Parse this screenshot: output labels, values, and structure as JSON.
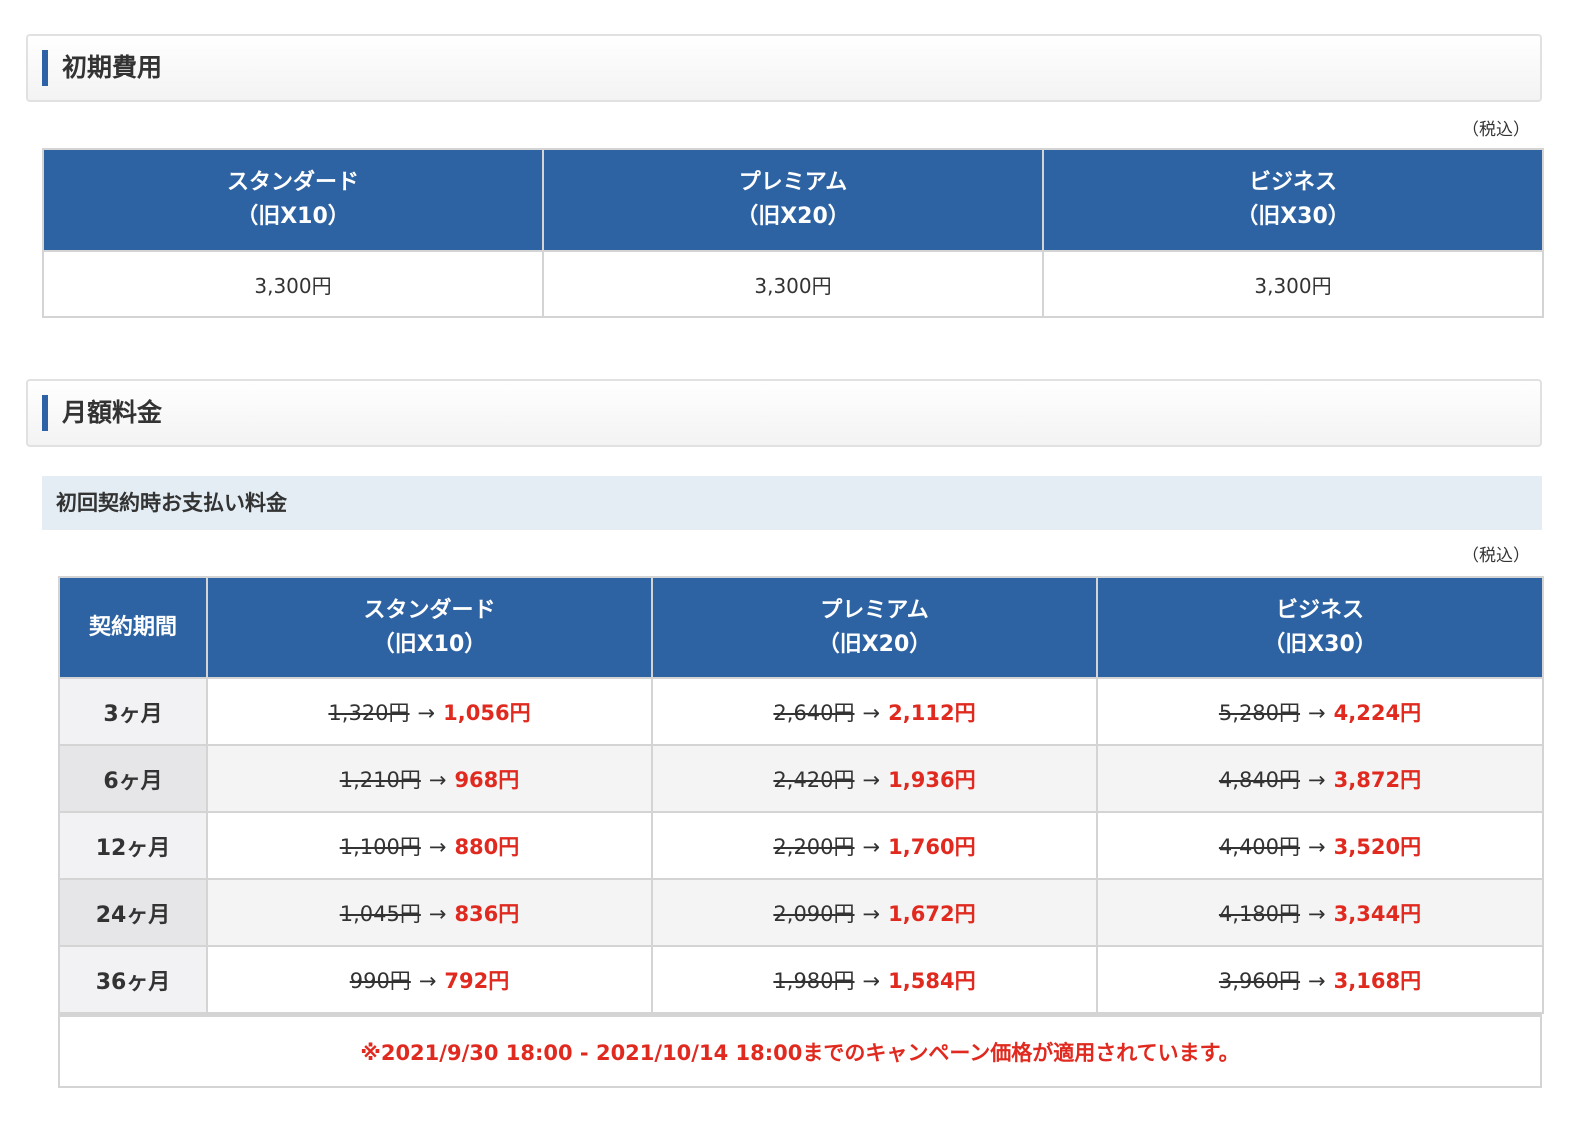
{
  "initial_fee": {
    "heading": "初期費用",
    "tax_note": "（税込）",
    "plans": [
      {
        "name": "スタンダード",
        "old_name": "（旧X10）",
        "price": "3,300円"
      },
      {
        "name": "プレミアム",
        "old_name": "（旧X20）",
        "price": "3,300円"
      },
      {
        "name": "ビジネス",
        "old_name": "（旧X30）",
        "price": "3,300円"
      }
    ]
  },
  "monthly_fee": {
    "heading": "月額料金",
    "subheading": "初回契約時お支払い料金",
    "tax_note": "（税込）",
    "period_header": "契約期間",
    "plans": [
      {
        "name": "スタンダード",
        "old_name": "（旧X10）"
      },
      {
        "name": "プレミアム",
        "old_name": "（旧X20）"
      },
      {
        "name": "ビジネス",
        "old_name": "（旧X30）"
      }
    ],
    "arrow": "→",
    "rows": [
      {
        "period": "3ヶ月",
        "prices": [
          {
            "old": "1,320円",
            "new": "1,056円"
          },
          {
            "old": "2,640円",
            "new": "2,112円"
          },
          {
            "old": "5,280円",
            "new": "4,224円"
          }
        ]
      },
      {
        "period": "6ヶ月",
        "prices": [
          {
            "old": "1,210円",
            "new": "968円"
          },
          {
            "old": "2,420円",
            "new": "1,936円"
          },
          {
            "old": "4,840円",
            "new": "3,872円"
          }
        ]
      },
      {
        "period": "12ヶ月",
        "prices": [
          {
            "old": "1,100円",
            "new": "880円"
          },
          {
            "old": "2,200円",
            "new": "1,760円"
          },
          {
            "old": "4,400円",
            "new": "3,520円"
          }
        ]
      },
      {
        "period": "24ヶ月",
        "prices": [
          {
            "old": "1,045円",
            "new": "836円"
          },
          {
            "old": "2,090円",
            "new": "1,672円"
          },
          {
            "old": "4,180円",
            "new": "3,344円"
          }
        ]
      },
      {
        "period": "36ヶ月",
        "prices": [
          {
            "old": "990円",
            "new": "792円"
          },
          {
            "old": "1,980円",
            "new": "1,584円"
          },
          {
            "old": "3,960円",
            "new": "3,168円"
          }
        ]
      }
    ],
    "campaign_note": "※2021/9/30 18:00 - 2021/10/14 18:00までのキャンペーン価格が適用されています。"
  },
  "colors": {
    "header_blue": "#2e63a3",
    "accent_bar": "#2d63a6",
    "sale_red": "#e02a20",
    "subheading_bg": "#e3edf3"
  }
}
